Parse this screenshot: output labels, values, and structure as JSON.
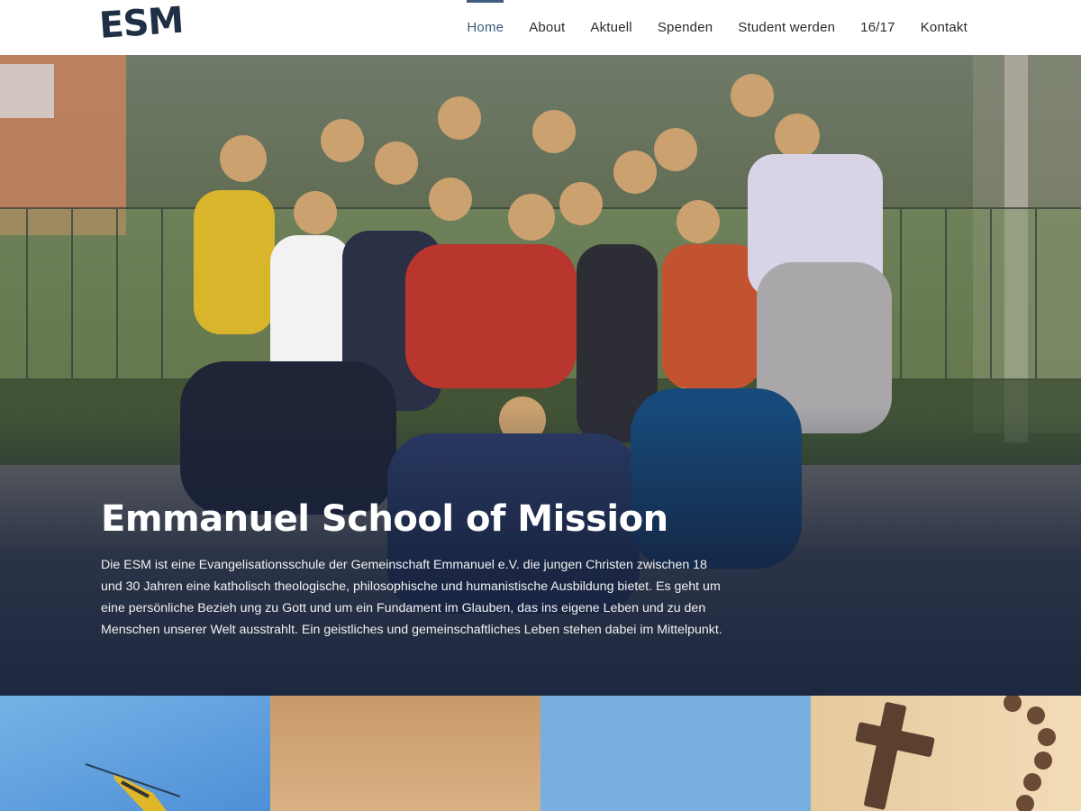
{
  "header": {
    "logo": "ESM",
    "nav": [
      {
        "label": "Home",
        "active": true
      },
      {
        "label": "About"
      },
      {
        "label": "Aktuell"
      },
      {
        "label": "Spenden"
      },
      {
        "label": "Student werden"
      },
      {
        "label": "16/17"
      },
      {
        "label": "Kontakt"
      }
    ]
  },
  "hero": {
    "title": "Emmanuel School of Mission",
    "text": "Die ESM ist eine Evangelisationsschule der Gemeinschaft Emmanuel e.V. die jungen Christen zwischen 18 und 30 Jahren eine katholisch theologische, philosophische und humanistische Ausbildung bietet. Es geht um eine persönliche Bezieh ung zu Gott und um ein Fundament im Glauben, das ins eigene Leben und zu den Menschen unserer Welt ausstrahlt. Ein geistliches und gemeinschaftliches Leben stehen dabei im Mittelpunkt."
  },
  "colors": {
    "accent": "#3f5e7f",
    "logo": "#1f2f45"
  }
}
